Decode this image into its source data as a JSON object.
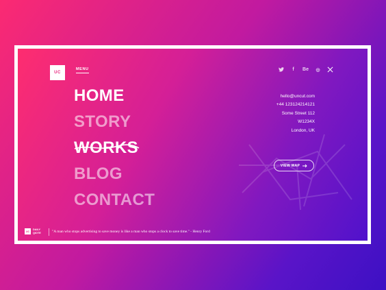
{
  "logo": {
    "text": "UC"
  },
  "menu": {
    "label": "MENU"
  },
  "nav": {
    "items": [
      {
        "label": "HOME"
      },
      {
        "label": "STORY"
      },
      {
        "label": "WORKS"
      },
      {
        "label": "BLOG"
      },
      {
        "label": "CONTACT"
      }
    ]
  },
  "social": {
    "items": [
      {
        "icon": "twitter-icon",
        "glyph": "🐦"
      },
      {
        "icon": "facebook-icon",
        "glyph": "f"
      },
      {
        "icon": "behance-icon",
        "glyph": "Be"
      },
      {
        "icon": "dribbble-icon",
        "glyph": "◎"
      }
    ]
  },
  "contact": {
    "email": "hello@uncut.com",
    "phone": "+44 123124214121",
    "street": "Some Street 112",
    "postcode": "W1234X",
    "city": "London, UK"
  },
  "map_button": {
    "label": "VIEW MAP"
  },
  "quote": {
    "badge": "UC",
    "label_line1": "DAILY",
    "label_line2": "QIOTE",
    "text": "\"A man who stops advertising to save money is like a man who stops a clock to save time.\" - Henry Ford"
  },
  "colors": {
    "accent": "#fe2d6f",
    "secondary": "#5012cc",
    "text": "#ffffff"
  }
}
